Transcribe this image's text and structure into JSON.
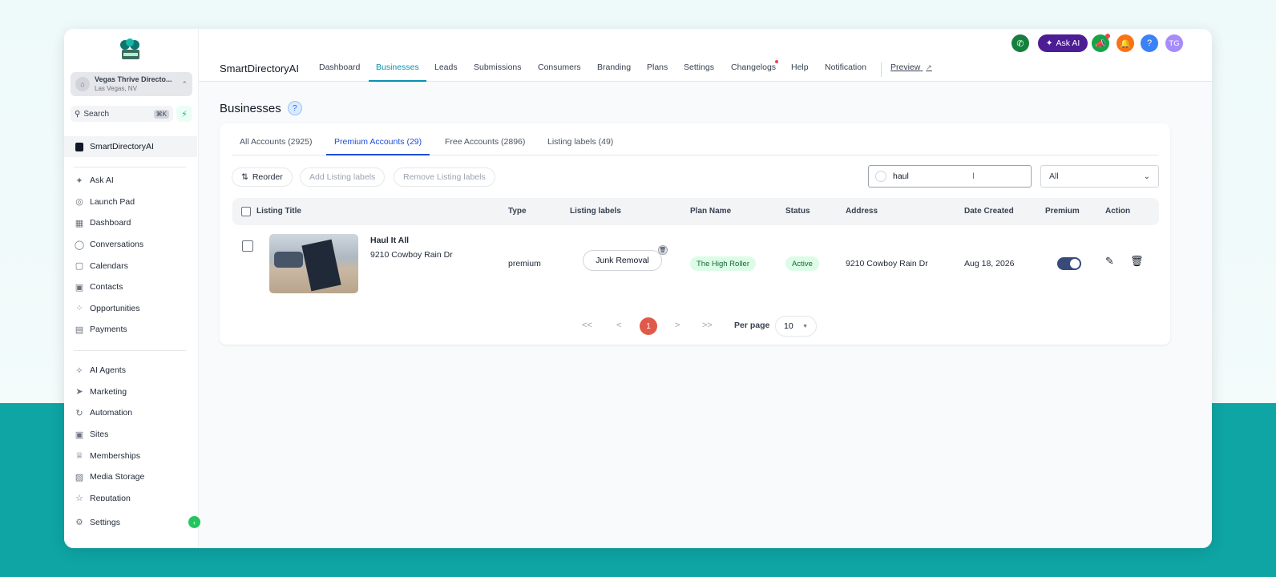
{
  "sidebar": {
    "location_name": "Vegas Thrive Directo...",
    "location_sub": "Las Vegas, NV",
    "search_label": "Search",
    "search_shortcut": "⌘K",
    "company": "SmartDirectoryAI",
    "items_primary": [
      {
        "icon": "✦",
        "label": "Ask AI",
        "name": "ask-ai"
      },
      {
        "icon": "◎",
        "label": "Launch Pad",
        "name": "launch-pad"
      },
      {
        "icon": "▦",
        "label": "Dashboard",
        "name": "dashboard"
      },
      {
        "icon": "◯",
        "label": "Conversations",
        "name": "conversations"
      },
      {
        "icon": "▢",
        "label": "Calendars",
        "name": "calendars"
      },
      {
        "icon": "▣",
        "label": "Contacts",
        "name": "contacts"
      },
      {
        "icon": "⁘",
        "label": "Opportunities",
        "name": "opportunities"
      },
      {
        "icon": "▤",
        "label": "Payments",
        "name": "payments"
      }
    ],
    "items_secondary": [
      {
        "icon": "✧",
        "label": "AI Agents",
        "name": "ai-agents"
      },
      {
        "icon": "➤",
        "label": "Marketing",
        "name": "marketing"
      },
      {
        "icon": "↻",
        "label": "Automation",
        "name": "automation"
      },
      {
        "icon": "▣",
        "label": "Sites",
        "name": "sites"
      },
      {
        "icon": "♕",
        "label": "Memberships",
        "name": "memberships"
      },
      {
        "icon": "▨",
        "label": "Media Storage",
        "name": "media-storage"
      },
      {
        "icon": "☆",
        "label": "Reputation",
        "name": "reputation"
      }
    ],
    "settings_label": "Settings"
  },
  "topbar": {
    "ask_ai_label": "Ask AI",
    "help_glyph": "?",
    "avatar_initials": "TG"
  },
  "module_nav": {
    "brand": "SmartDirectoryAI",
    "items": [
      "Dashboard",
      "Businesses",
      "Leads",
      "Submissions",
      "Consumers",
      "Branding",
      "Plans",
      "Settings",
      "Changelogs",
      "Help",
      "Notification"
    ],
    "active": "Businesses",
    "preview": "Preview"
  },
  "page": {
    "title": "Businesses",
    "help_glyph": "?"
  },
  "tabs": [
    "All Accounts (2925)",
    "Premium Accounts (29)",
    "Free Accounts (2896)",
    "Listing labels (49)"
  ],
  "toolbar": {
    "reorder": "Reorder",
    "add_labels": "Add Listing labels",
    "remove_labels": "Remove Listing labels",
    "search_value": "haul",
    "filter_value": "All"
  },
  "table": {
    "columns": [
      "Listing Title",
      "Type",
      "Listing labels",
      "Plan Name",
      "Status",
      "Address",
      "Date Created",
      "Premium",
      "Action"
    ],
    "rows": [
      {
        "title": "Haul It All",
        "subtitle": "9210 Cowboy Rain Dr",
        "type": "premium",
        "label": "Junk Removal",
        "plan": "The High Roller",
        "status": "Active",
        "address": "9210 Cowboy Rain Dr",
        "date": "Aug 18, 2026",
        "premium": true
      }
    ]
  },
  "pagination": {
    "first": "<<",
    "prev": "<",
    "current": "1",
    "next": ">",
    "last": ">>",
    "per_page_label": "Per page",
    "per_page_value": "10"
  },
  "colors": {
    "accent_teal": "#0891b2",
    "tab_blue": "#1d4ed8",
    "page_active": "#e05a4a",
    "askai_purple": "#4c1d95"
  }
}
